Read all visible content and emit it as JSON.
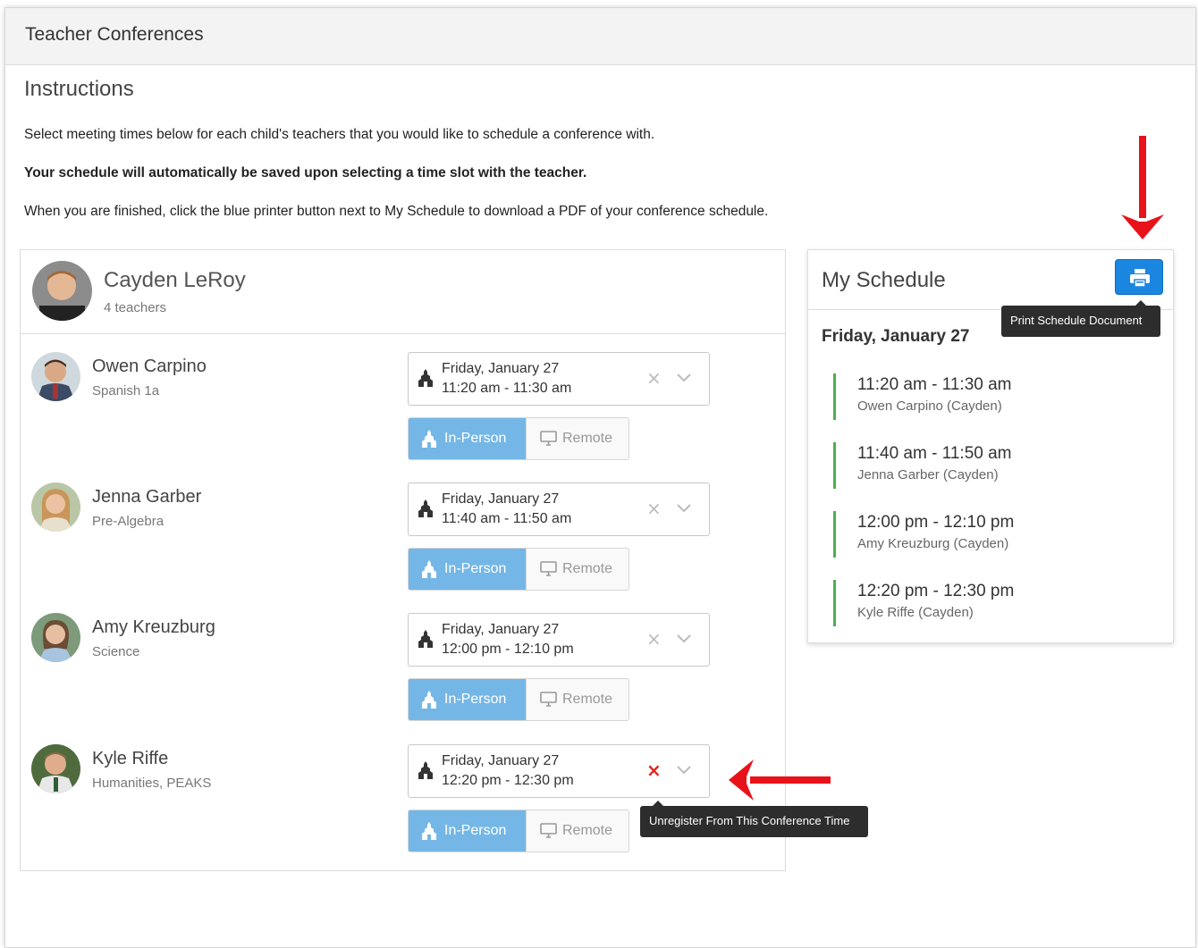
{
  "header": {
    "title": "Teacher Conferences"
  },
  "instructions": {
    "title": "Instructions",
    "line1": "Select meeting times below for each child's teachers that you would like to schedule a conference with.",
    "line2": "Your schedule will automatically be saved upon selecting a time slot with the teacher.",
    "line3": "When you are finished, click the blue printer button next to My Schedule to download a PDF of your conference schedule."
  },
  "student": {
    "name": "Cayden LeRoy",
    "teacher_count": "4 teachers"
  },
  "teachers": [
    {
      "name": "Owen Carpino",
      "subject": "Spanish 1a",
      "date": "Friday, January 27",
      "time": "11:20 am - 11:30 am",
      "mode_inperson": "In-Person",
      "mode_remote": "Remote",
      "clear": "×"
    },
    {
      "name": "Jenna Garber",
      "subject": "Pre-Algebra",
      "date": "Friday, January 27",
      "time": "11:40 am - 11:50 am",
      "mode_inperson": "In-Person",
      "mode_remote": "Remote",
      "clear": "×"
    },
    {
      "name": "Amy Kreuzburg",
      "subject": "Science",
      "date": "Friday, January 27",
      "time": "12:00 pm - 12:10 pm",
      "mode_inperson": "In-Person",
      "mode_remote": "Remote",
      "clear": "×"
    },
    {
      "name": "Kyle Riffe",
      "subject": "Humanities, PEAKS",
      "date": "Friday, January 27",
      "time": "12:20 pm - 12:30 pm",
      "mode_inperson": "In-Person",
      "mode_remote": "Remote",
      "clear": "×"
    }
  ],
  "schedule": {
    "title": "My Schedule",
    "print_tooltip": "Print Schedule Document",
    "date": "Friday, January 27",
    "entries": [
      {
        "time": "11:20 am - 11:30 am",
        "who": "Owen Carpino (Cayden)"
      },
      {
        "time": "11:40 am - 11:50 am",
        "who": "Jenna Garber (Cayden)"
      },
      {
        "time": "12:00 pm - 12:10 pm",
        "who": "Amy Kreuzburg (Cayden)"
      },
      {
        "time": "12:20 pm - 12:30 pm",
        "who": "Kyle Riffe (Cayden)"
      }
    ]
  },
  "unregister_tooltip": "Unregister From This Conference Time",
  "colors": {
    "accent_blue": "#1a86e0",
    "inperson_blue": "#74b7e6",
    "green_bar": "#4cb050",
    "annotation_red": "#e8121a"
  },
  "icons": {
    "print": "printer-icon",
    "building": "building-icon",
    "monitor": "monitor-icon",
    "clear": "close-icon",
    "dropdown": "chevron-down-icon"
  }
}
